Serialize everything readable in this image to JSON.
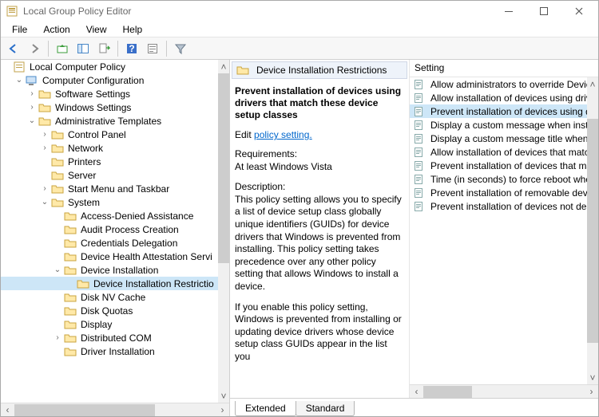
{
  "window": {
    "title": "Local Group Policy Editor"
  },
  "menu": {
    "file": "File",
    "action": "Action",
    "view": "View",
    "help": "Help"
  },
  "tree": {
    "root": "Local Computer Policy",
    "compConfig": "Computer Configuration",
    "software": "Software Settings",
    "windows": "Windows Settings",
    "admin": "Administrative Templates",
    "controlPanel": "Control Panel",
    "network": "Network",
    "printers": "Printers",
    "server": "Server",
    "startMenu": "Start Menu and Taskbar",
    "system": "System",
    "ada": "Access-Denied Assistance",
    "audit": "Audit Process Creation",
    "cred": "Credentials Delegation",
    "dhas": "Device Health Attestation Servi",
    "devinst": "Device Installation",
    "devinstres": "Device Installation Restrictio",
    "disknv": "Disk NV Cache",
    "diskq": "Disk Quotas",
    "display": "Display",
    "dcom": "Distributed COM",
    "drvinst": "Driver Installation"
  },
  "detail": {
    "bandTitle": "Device Installation Restrictions",
    "title": "Prevent installation of devices using drivers that match these device setup classes",
    "editPrefix": "Edit ",
    "editLink": "policy setting.",
    "reqLabel": "Requirements:",
    "reqValue": "At least Windows Vista",
    "descLabel": "Description:",
    "descBody": "This policy setting allows you to specify a list of device setup class globally unique identifiers (GUIDs) for device drivers that Windows is prevented from installing. This policy setting takes precedence over any other policy setting that allows Windows to install a device.",
    "descBody2": "If you enable this policy setting, Windows is prevented from installing or updating device drivers whose device setup class GUIDs appear in the list you"
  },
  "list": {
    "header": "Setting",
    "items": [
      "Allow administrators to override Device Inst",
      "Allow installation of devices using drivers th",
      "Prevent installation of devices using drivers",
      "Display a custom message when installatior",
      "Display a custom message title when device",
      "Allow installation of devices that match any",
      "Prevent installation of devices that match a",
      "Time (in seconds) to force reboot when req",
      "Prevent installation of removable devices",
      "Prevent installation of devices not described"
    ],
    "selectedIndex": 2
  },
  "tabs": {
    "extended": "Extended",
    "standard": "Standard"
  }
}
